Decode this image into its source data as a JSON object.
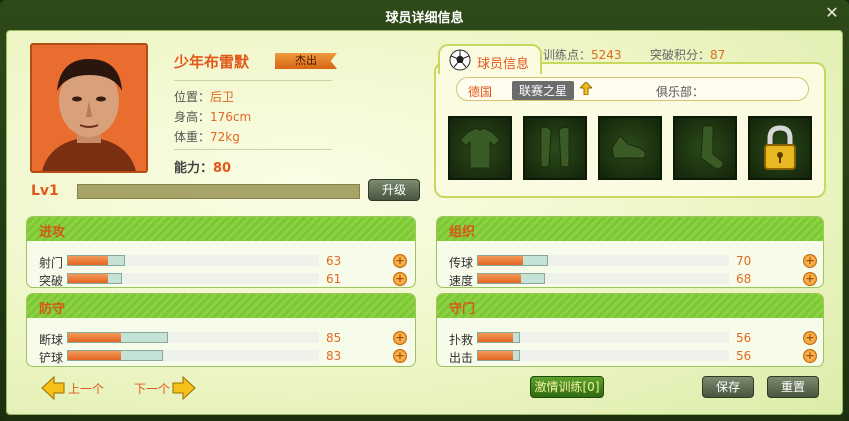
{
  "window": {
    "title": "球员详细信息",
    "close": "✕"
  },
  "player": {
    "name": "少年布雷默",
    "badge": "杰出",
    "position_label": "位置：",
    "position": "后卫",
    "height_label": "身高：",
    "height": "176cm",
    "weight_label": "体重：",
    "weight": "72kg",
    "ability_label": "能力：",
    "ability": "80",
    "level": "Lv1",
    "xp_progress": 0,
    "upgrade_label": "升级"
  },
  "info_panel": {
    "tab_title": "球员信息",
    "training_label": "训练点：",
    "training_points": "5243",
    "breakthrough_label": "突破积分：",
    "breakthrough_points": "87",
    "country": "德国",
    "star_tag": "联赛之星",
    "club_label": "俱乐部：",
    "equipment": [
      "shirt-icon",
      "shin-guard-icon",
      "boots-icon",
      "sock-icon",
      "lock-icon"
    ]
  },
  "stats": {
    "attack": {
      "title": "进攻",
      "rows": [
        {
          "label": "射门",
          "value": "63",
          "fill": 0.16,
          "track": 0.23
        },
        {
          "label": "突破",
          "value": "61",
          "fill": 0.16,
          "track": 0.22
        }
      ]
    },
    "organize": {
      "title": "组织",
      "rows": [
        {
          "label": "传球",
          "value": "70",
          "fill": 0.18,
          "track": 0.28
        },
        {
          "label": "速度",
          "value": "68",
          "fill": 0.17,
          "track": 0.27
        }
      ]
    },
    "defense": {
      "title": "防守",
      "rows": [
        {
          "label": "断球",
          "value": "85",
          "fill": 0.21,
          "track": 0.4
        },
        {
          "label": "铲球",
          "value": "83",
          "fill": 0.21,
          "track": 0.38
        }
      ]
    },
    "goalkeeping": {
      "title": "守门",
      "rows": [
        {
          "label": "扑救",
          "value": "56",
          "fill": 0.14,
          "track": 0.17
        },
        {
          "label": "出击",
          "value": "56",
          "fill": 0.14,
          "track": 0.17
        }
      ]
    }
  },
  "footer": {
    "prev": "上一个",
    "next": "下一个",
    "training": "激情训练[0]",
    "save": "保存",
    "reset": "重置"
  }
}
